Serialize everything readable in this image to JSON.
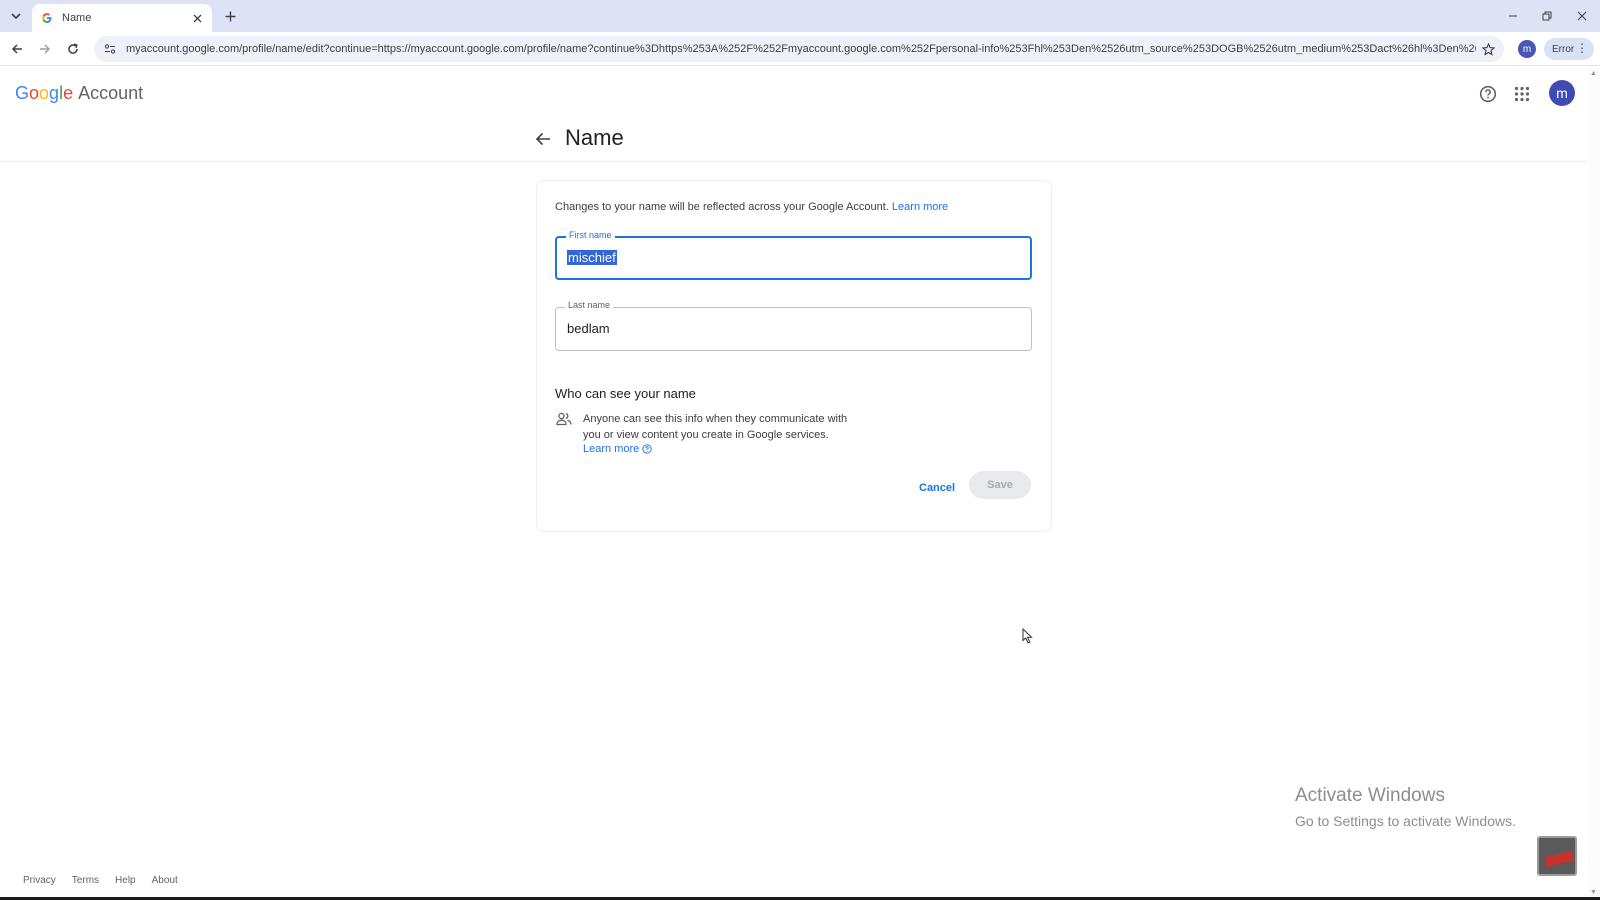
{
  "browser": {
    "tab_title": "Name",
    "url": "myaccount.google.com/profile/name/edit?continue=https://myaccount.google.com/profile/name?continue%3Dhttps%253A%252F%252Fmyaccount.google.com%252Fpersonal-info%253Fhl%253Den%2526utm_source%253DOGB%2526utm_medium%253Dact%26hl%3Den%26u...",
    "profile_initial": "m",
    "error_chip": "Error"
  },
  "header": {
    "logo_letters": [
      "G",
      "o",
      "o",
      "g",
      "l",
      "e"
    ],
    "logo_colors": [
      "#4285F4",
      "#EA4335",
      "#FBBC05",
      "#4285F4",
      "#34A853",
      "#EA4335"
    ],
    "logo_suffix": "Account",
    "avatar_initial": "m",
    "page_title": "Name"
  },
  "card": {
    "intro_text": "Changes to your name will be reflected across your Google Account.",
    "intro_link": "Learn more",
    "first_name": {
      "label": "First name",
      "value": "mischief"
    },
    "last_name": {
      "label": "Last name",
      "value": "bedlam"
    },
    "who_title": "Who can see your name",
    "who_text": "Anyone can see this info when they communicate with you or view content you create in Google services.",
    "who_link": "Learn more",
    "cancel_label": "Cancel",
    "save_label": "Save"
  },
  "watermark": {
    "line1": "Activate Windows",
    "line2": "Go to Settings to activate Windows."
  },
  "footer": {
    "links": [
      "Privacy",
      "Terms",
      "Help",
      "About"
    ]
  },
  "colors": {
    "accent": "#1a73e8",
    "avatar": "#3f4ab3"
  }
}
